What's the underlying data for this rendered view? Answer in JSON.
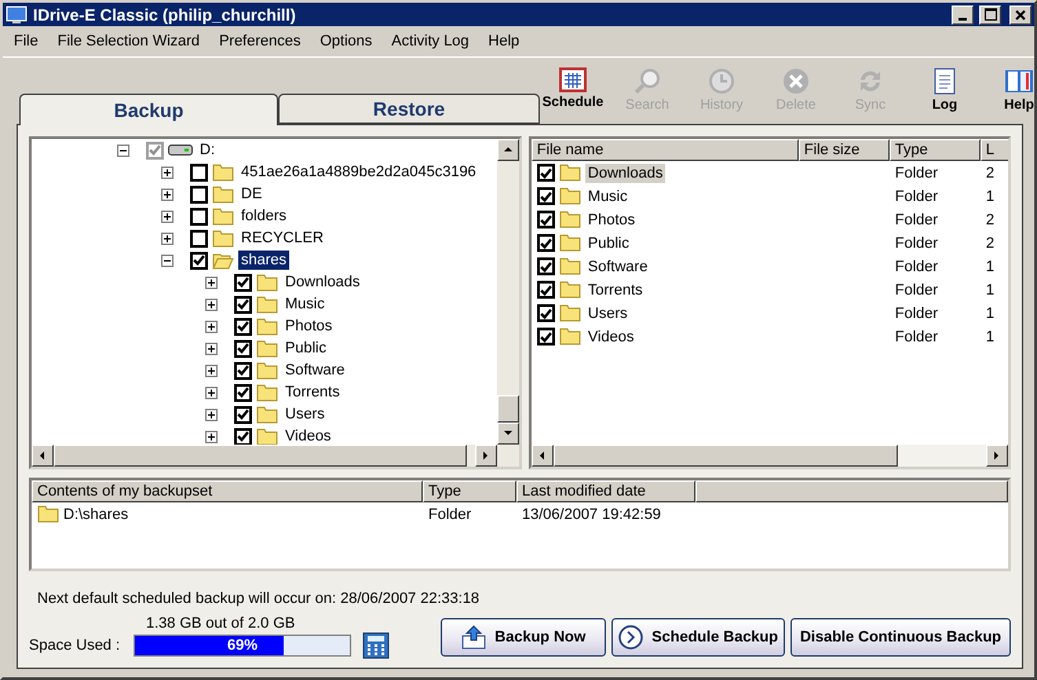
{
  "window": {
    "title": "IDrive-E Classic (philip_churchill)"
  },
  "menu": [
    {
      "label": "File"
    },
    {
      "label": "File Selection Wizard"
    },
    {
      "label": "Preferences"
    },
    {
      "label": "Options"
    },
    {
      "label": "Activity Log"
    },
    {
      "label": "Help"
    }
  ],
  "tabs": [
    {
      "label": "Backup",
      "selected": true
    },
    {
      "label": "Restore",
      "selected": false
    }
  ],
  "toolbar": [
    {
      "label": "Schedule",
      "kind": "schedule",
      "disabled": false
    },
    {
      "label": "Search",
      "kind": "search",
      "disabled": true
    },
    {
      "label": "History",
      "kind": "history",
      "disabled": true
    },
    {
      "label": "Delete",
      "kind": "delete",
      "disabled": true
    },
    {
      "label": "Sync",
      "kind": "sync",
      "disabled": true
    },
    {
      "label": "Log",
      "kind": "log",
      "disabled": false
    },
    {
      "label": "Help",
      "kind": "help",
      "disabled": false
    }
  ],
  "tree": [
    {
      "label": "D:",
      "kind": "drive",
      "expanded": true,
      "checked": true,
      "selected": false,
      "children": [
        {
          "label": "451ae26a1a4889be2d2a045c3196",
          "kind": "folder",
          "expanded": false,
          "checked": false,
          "selected": false
        },
        {
          "label": "DE",
          "kind": "folder",
          "expanded": false,
          "checked": false,
          "selected": false
        },
        {
          "label": "folders",
          "kind": "folder",
          "expanded": false,
          "checked": false,
          "selected": false
        },
        {
          "label": "RECYCLER",
          "kind": "folder",
          "expanded": false,
          "checked": false,
          "selected": false
        },
        {
          "label": "shares",
          "kind": "open-folder",
          "expanded": true,
          "checked": true,
          "selected": true,
          "children": [
            {
              "label": "Downloads",
              "kind": "folder",
              "expanded": false,
              "checked": true,
              "selected": false
            },
            {
              "label": "Music",
              "kind": "folder",
              "expanded": false,
              "checked": true,
              "selected": false
            },
            {
              "label": "Photos",
              "kind": "folder",
              "expanded": false,
              "checked": true,
              "selected": false
            },
            {
              "label": "Public",
              "kind": "folder",
              "expanded": false,
              "checked": true,
              "selected": false
            },
            {
              "label": "Software",
              "kind": "folder",
              "expanded": false,
              "checked": true,
              "selected": false
            },
            {
              "label": "Torrents",
              "kind": "folder",
              "expanded": false,
              "checked": true,
              "selected": false
            },
            {
              "label": "Users",
              "kind": "folder",
              "expanded": false,
              "checked": true,
              "selected": false
            },
            {
              "label": "Videos",
              "kind": "folder",
              "expanded": false,
              "checked": true,
              "selected": false
            }
          ]
        }
      ]
    }
  ],
  "file_list": {
    "columns": [
      "File name",
      "File size",
      "Type",
      "L"
    ],
    "rows": [
      {
        "name": "Downloads",
        "type": "Folder",
        "column_4": "2",
        "checked": true,
        "selected": true
      },
      {
        "name": "Music",
        "type": "Folder",
        "column_4": "1",
        "checked": true,
        "selected": false
      },
      {
        "name": "Photos",
        "type": "Folder",
        "column_4": "2",
        "checked": true,
        "selected": false
      },
      {
        "name": "Public",
        "type": "Folder",
        "column_4": "2",
        "checked": true,
        "selected": false
      },
      {
        "name": "Software",
        "type": "Folder",
        "column_4": "1",
        "checked": true,
        "selected": false
      },
      {
        "name": "Torrents",
        "type": "Folder",
        "column_4": "1",
        "checked": true,
        "selected": false
      },
      {
        "name": "Users",
        "type": "Folder",
        "column_4": "1",
        "checked": true,
        "selected": false
      },
      {
        "name": "Videos",
        "type": "Folder",
        "column_4": "1",
        "checked": true,
        "selected": false
      }
    ]
  },
  "backupset": {
    "columns": [
      "Contents of my backupset",
      "Type",
      "Last modified date"
    ],
    "rows": [
      {
        "name": "D:\\shares",
        "type": "Folder",
        "date": "13/06/2007 19:42:59"
      }
    ]
  },
  "schedule_notice": "Next default scheduled backup will occur on: 28/06/2007 22:33:18",
  "space": {
    "label": "Space Used :",
    "usage": "1.38 GB out of 2.0 GB",
    "level": 0.69,
    "percent": "69%"
  },
  "buttons": [
    {
      "label": "Backup Now",
      "kind": "backup"
    },
    {
      "label": "Schedule Backup",
      "kind": "schedule"
    },
    {
      "label": "Disable Continuous Backup",
      "kind": "plain"
    }
  ]
}
